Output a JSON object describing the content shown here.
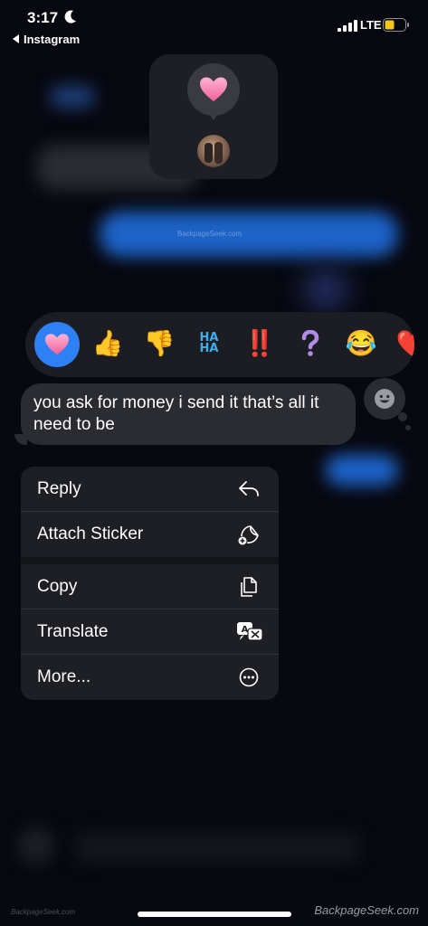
{
  "status_bar": {
    "time": "3:17",
    "back_app": "Instagram",
    "network": "LTE",
    "battery_color": "#f5c518"
  },
  "background": {
    "watermark": "BackpageSeek.com"
  },
  "reaction_summary": {
    "reaction_icon": "pink-heart-icon",
    "reactor": "avatar"
  },
  "reaction_bar": {
    "emojis": [
      {
        "name": "pink-heart",
        "glyph": "💗",
        "selected": true
      },
      {
        "name": "thumbs-up",
        "glyph": "👍"
      },
      {
        "name": "thumbs-down",
        "glyph": "👎"
      },
      {
        "name": "haha",
        "glyph": "HA HA"
      },
      {
        "name": "double-exclamation",
        "glyph": "‼️"
      },
      {
        "name": "question",
        "glyph": "❓"
      },
      {
        "name": "laughing",
        "glyph": "😂"
      },
      {
        "name": "heart-partial",
        "glyph": "❤️"
      }
    ],
    "accent": "#2f7ff5"
  },
  "message": {
    "text": "you ask for money i send it that’s all it need to be"
  },
  "context_menu": {
    "items": [
      {
        "label": "Reply",
        "icon": "reply-icon"
      },
      {
        "label": "Attach Sticker",
        "icon": "sticker-icon"
      },
      {
        "label": "Copy",
        "icon": "copy-icon"
      },
      {
        "label": "Translate",
        "icon": "translate-icon"
      },
      {
        "label": "More...",
        "icon": "more-icon"
      }
    ]
  },
  "footer": {
    "watermark": "BackpageSeek.com",
    "watermark_small": "BackpageSeek.com"
  }
}
